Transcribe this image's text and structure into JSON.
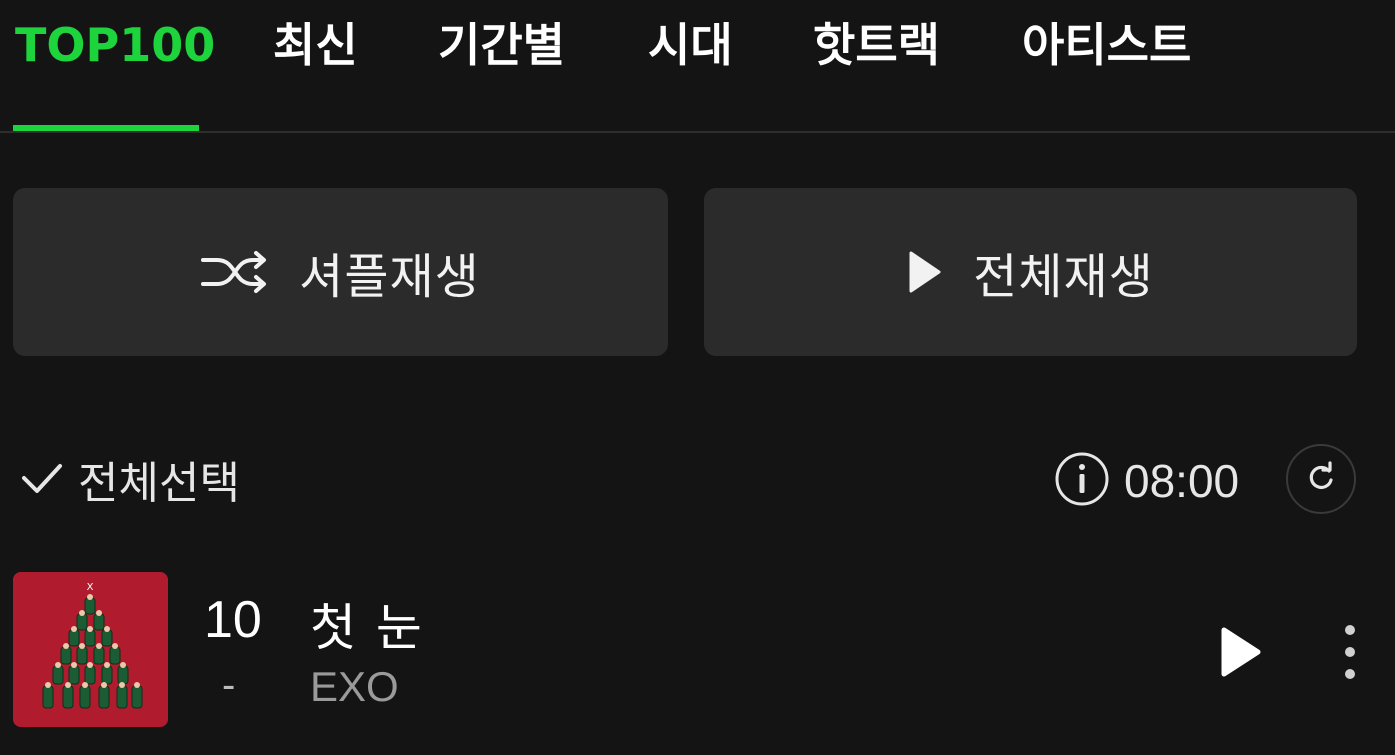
{
  "tabs": [
    {
      "label": "TOP100",
      "active": true
    },
    {
      "label": "최신",
      "active": false
    },
    {
      "label": "기간별",
      "active": false
    },
    {
      "label": "시대",
      "active": false
    },
    {
      "label": "핫트랙",
      "active": false
    },
    {
      "label": "아티스트",
      "active": false
    }
  ],
  "actions": {
    "shuffle_label": "셔플재생",
    "shuffle_icon": "shuffle-icon",
    "play_all_label": "전체재생",
    "play_all_icon": "play-icon"
  },
  "list_header": {
    "select_all_label": "전체선택",
    "select_all_icon": "check-icon",
    "info_icon": "info-icon",
    "updated_time": "08:00",
    "refresh_icon": "refresh-icon"
  },
  "tracks": [
    {
      "rank": "10",
      "rank_change": "-",
      "title": "첫 눈",
      "artist": "EXO",
      "play_icon": "play-icon",
      "more_icon": "more-vertical-icon"
    }
  ],
  "colors": {
    "accent": "#1ed43c",
    "background": "#141414",
    "button_bg": "#2b2b2b",
    "album_bg": "#b01c2e"
  }
}
